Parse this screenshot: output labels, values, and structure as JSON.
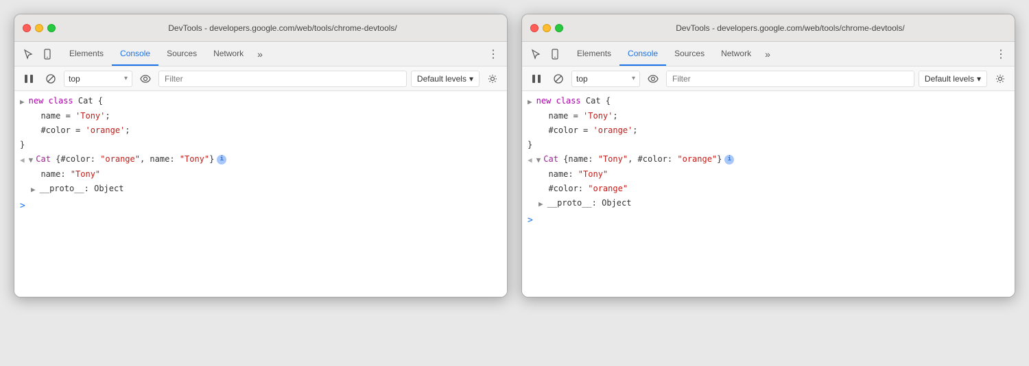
{
  "windows": [
    {
      "id": "window-left",
      "title": "DevTools - developers.google.com/web/tools/chrome-devtools/",
      "tabs": [
        {
          "id": "tab-elements-1",
          "label": "Elements",
          "active": false
        },
        {
          "id": "tab-console-1",
          "label": "Console",
          "active": true
        },
        {
          "id": "tab-sources-1",
          "label": "Sources",
          "active": false
        },
        {
          "id": "tab-network-1",
          "label": "Network",
          "active": false
        }
      ],
      "toolbar": {
        "top_label": "top",
        "filter_placeholder": "Filter",
        "default_levels": "Default levels"
      },
      "console_lines": [
        {
          "type": "input",
          "arrow": "▶",
          "content": "new class Cat {",
          "color": "default"
        },
        {
          "type": "code",
          "indent": 1,
          "content": "  name = 'Tony';"
        },
        {
          "type": "code",
          "indent": 1,
          "content": "  #color = 'orange';"
        },
        {
          "type": "code",
          "indent": 0,
          "content": "}"
        },
        {
          "type": "output",
          "arrow_left": "◀",
          "arrow_down": "▼",
          "class_name": "Cat",
          "summary": "{#color: ",
          "summary_color": "\"orange\"",
          "summary_mid": ", name: ",
          "summary_name": "\"Tony\"",
          "summary_end": "}",
          "show_info": true
        },
        {
          "type": "prop",
          "indent": 1,
          "label": "name:",
          "value": "\"Tony\"",
          "value_color": "red"
        },
        {
          "type": "proto",
          "indent": 1,
          "arrow": "▶",
          "content": "__proto__: Object"
        }
      ]
    },
    {
      "id": "window-right",
      "title": "DevTools - developers.google.com/web/tools/chrome-devtools/",
      "tabs": [
        {
          "id": "tab-elements-2",
          "label": "Elements",
          "active": false
        },
        {
          "id": "tab-console-2",
          "label": "Console",
          "active": true
        },
        {
          "id": "tab-sources-2",
          "label": "Sources",
          "active": false
        },
        {
          "id": "tab-network-2",
          "label": "Network",
          "active": false
        }
      ],
      "toolbar": {
        "top_label": "top",
        "filter_placeholder": "Filter",
        "default_levels": "Default levels"
      },
      "console_lines_right": [
        {
          "type": "input",
          "content": "new class Cat {"
        },
        {
          "type": "code",
          "content": "  name = 'Tony';"
        },
        {
          "type": "code",
          "content": "  #color = 'orange';"
        },
        {
          "type": "code",
          "content": "}"
        },
        {
          "type": "output_right",
          "class_name": "Cat",
          "summary": "{name: ",
          "summary_name": "\"Tony\"",
          "summary_mid": ", #color: ",
          "summary_color": "\"orange\"",
          "summary_end": "}"
        },
        {
          "type": "prop",
          "label": "name:",
          "value": "\"Tony\"",
          "value_color": "red"
        },
        {
          "type": "prop",
          "label": "#color:",
          "value": "\"orange\"",
          "value_color": "red"
        },
        {
          "type": "proto",
          "content": "__proto__: Object"
        }
      ]
    }
  ],
  "icons": {
    "cursor": "⬚",
    "pointer": "↖",
    "mobile": "▣",
    "ban": "⊘",
    "play": "▶",
    "eye": "◎",
    "gear": "⚙",
    "more": "⋮",
    "more2": "»"
  }
}
